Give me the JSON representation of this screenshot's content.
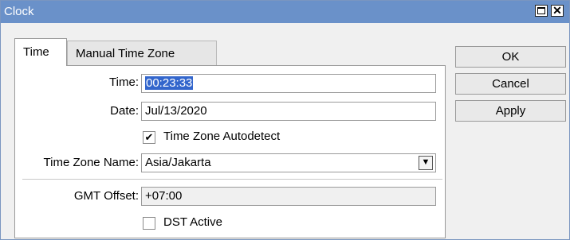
{
  "window": {
    "title": "Clock"
  },
  "tabs": [
    {
      "label": "Time",
      "selected": true
    },
    {
      "label": "Manual Time Zone",
      "selected": false
    }
  ],
  "form": {
    "time_label": "Time:",
    "time_value": "00:23:33",
    "date_label": "Date:",
    "date_value": "Jul/13/2020",
    "autodetect_label": "Time Zone Autodetect",
    "autodetect_checked": true,
    "autodetect_mark": "✔",
    "tz_name_label": "Time Zone Name:",
    "tz_name_value": "Asia/Jakarta",
    "gmt_offset_label": "GMT Offset:",
    "gmt_offset_value": "+07:00",
    "dst_label": "DST Active",
    "dst_checked": false
  },
  "buttons": {
    "ok": "OK",
    "cancel": "Cancel",
    "apply": "Apply"
  },
  "titlebar_buttons": {
    "close": "✕"
  },
  "icons": {
    "dropdown": "dropdown-arrow-icon",
    "maximize": "maximize-icon",
    "close": "close-icon"
  },
  "colors": {
    "titlebar": "#6a91c9",
    "selection": "#3366cc",
    "panel_bg": "#ffffff",
    "window_bg": "#f0f0f0"
  }
}
